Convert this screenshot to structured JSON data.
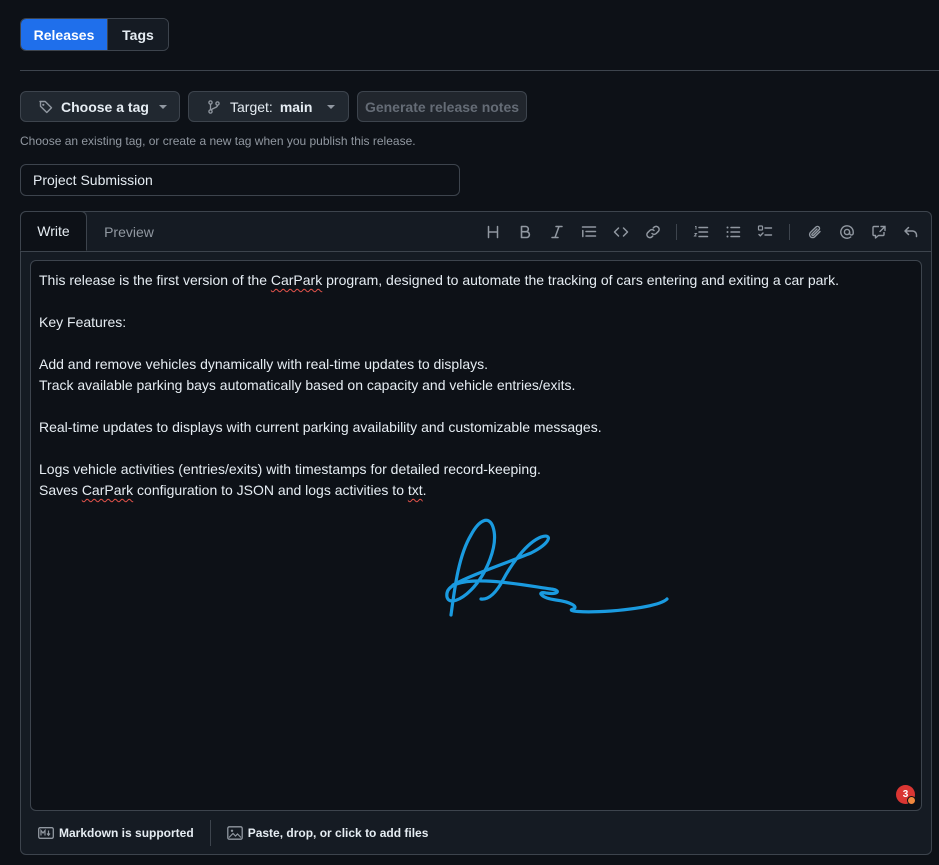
{
  "tabs": {
    "releases": "Releases",
    "tags": "Tags"
  },
  "toolbar": {
    "choose_tag": "Choose a tag",
    "target_label": "Target:",
    "target_value": "main",
    "generate_notes": "Generate release notes"
  },
  "hint": "Choose an existing tag, or create a new tag when you publish this release.",
  "release_title": {
    "value": "Project Submission"
  },
  "editor": {
    "tab_write": "Write",
    "tab_preview": "Preview",
    "body": [
      "This release is the first version of the CarPark program, designed to automate the tracking of cars entering and exiting a car park.",
      "Key Features:",
      "Add and remove vehicles dynamically with real-time updates to displays.",
      "Track available parking bays automatically based on capacity and vehicle entries/exits.",
      "Real-time updates to displays with current parking availability and customizable messages.",
      "Logs vehicle activities (entries/exits) with timestamps for detailed record-keeping.",
      "Saves CarPark configuration to JSON and logs activities to txt."
    ],
    "notification_count": "3",
    "footer_markdown": "Markdown is supported",
    "footer_attach": "Paste, drop, or click to add files"
  },
  "icons": {
    "heading": "heading-icon",
    "bold": "bold-icon",
    "italic": "italic-icon",
    "quote": "quote-icon",
    "code": "code-icon",
    "link": "link-icon",
    "ordered_list": "ordered-list-icon",
    "unordered_list": "unordered-list-icon",
    "task_list": "task-list-icon",
    "attach": "paperclip-icon",
    "mention": "mention-icon",
    "reference": "cross-reference-icon",
    "undo": "undo-icon"
  },
  "colors": {
    "accent": "#1f6feb",
    "background": "#0d1117",
    "signature": "#1a9be0",
    "badge": "#da3633"
  }
}
